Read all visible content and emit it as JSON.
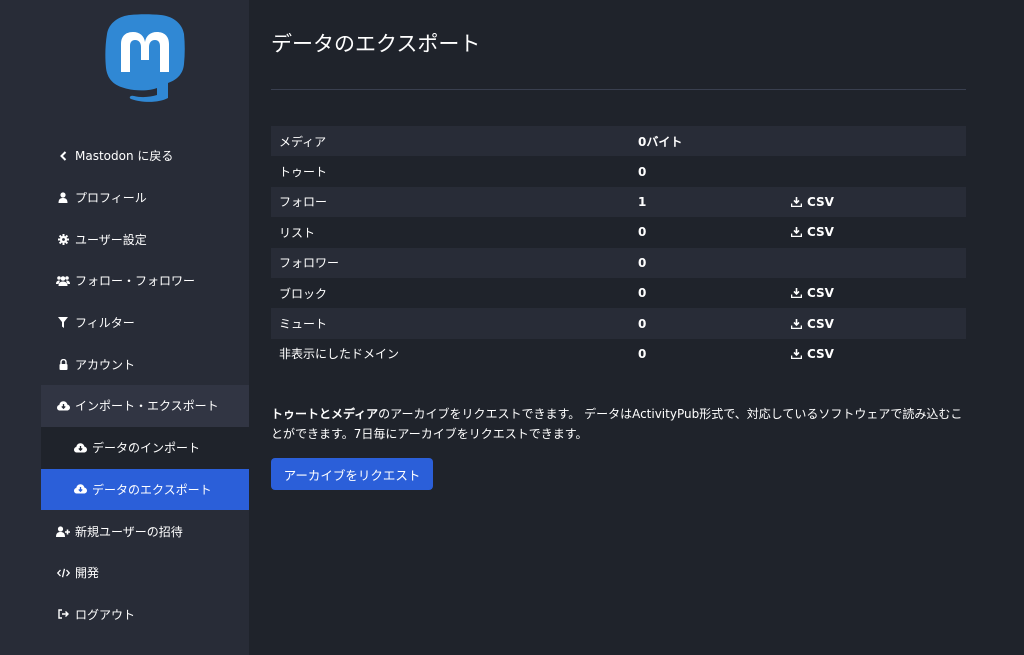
{
  "colors": {
    "sidebar_bg": "#282c37",
    "content_bg": "#1f232b",
    "accent": "#2b5fd9",
    "logo": "#3088d4"
  },
  "sidebar": {
    "items": [
      {
        "label": "Mastodon に戻る",
        "icon": "chevron-left-icon"
      },
      {
        "label": "プロフィール",
        "icon": "user-icon"
      },
      {
        "label": "ユーザー設定",
        "icon": "cog-icon"
      },
      {
        "label": "フォロー・フォロワー",
        "icon": "users-icon"
      },
      {
        "label": "フィルター",
        "icon": "filter-icon"
      },
      {
        "label": "アカウント",
        "icon": "lock-icon"
      },
      {
        "label": "インポート・エクスポート",
        "icon": "cloud-download-icon"
      },
      {
        "label": "データのインポート",
        "icon": "cloud-upload-icon"
      },
      {
        "label": "データのエクスポート",
        "icon": "cloud-download-icon"
      },
      {
        "label": "新規ユーザーの招待",
        "icon": "user-plus-icon"
      },
      {
        "label": "開発",
        "icon": "code-icon"
      },
      {
        "label": "ログアウト",
        "icon": "sign-out-icon"
      }
    ]
  },
  "main": {
    "title": "データのエクスポート",
    "table": {
      "rows": [
        {
          "label": "メディア",
          "value": "0バイト",
          "csv": ""
        },
        {
          "label": "トゥート",
          "value": "0",
          "csv": ""
        },
        {
          "label": "フォロー",
          "value": "1",
          "csv": "CSV"
        },
        {
          "label": "リスト",
          "value": "0",
          "csv": "CSV"
        },
        {
          "label": "フォロワー",
          "value": "0",
          "csv": ""
        },
        {
          "label": "ブロック",
          "value": "0",
          "csv": "CSV"
        },
        {
          "label": "ミュート",
          "value": "0",
          "csv": "CSV"
        },
        {
          "label": "非表示にしたドメイン",
          "value": "0",
          "csv": "CSV"
        }
      ]
    },
    "description_bold": "トゥートとメディア",
    "description_rest": "のアーカイブをリクエストできます。 データはActivityPub形式で、対応しているソフトウェアで読み込むことができます。7日毎にアーカイブをリクエストできます。",
    "request_button": "アーカイブをリクエスト"
  }
}
